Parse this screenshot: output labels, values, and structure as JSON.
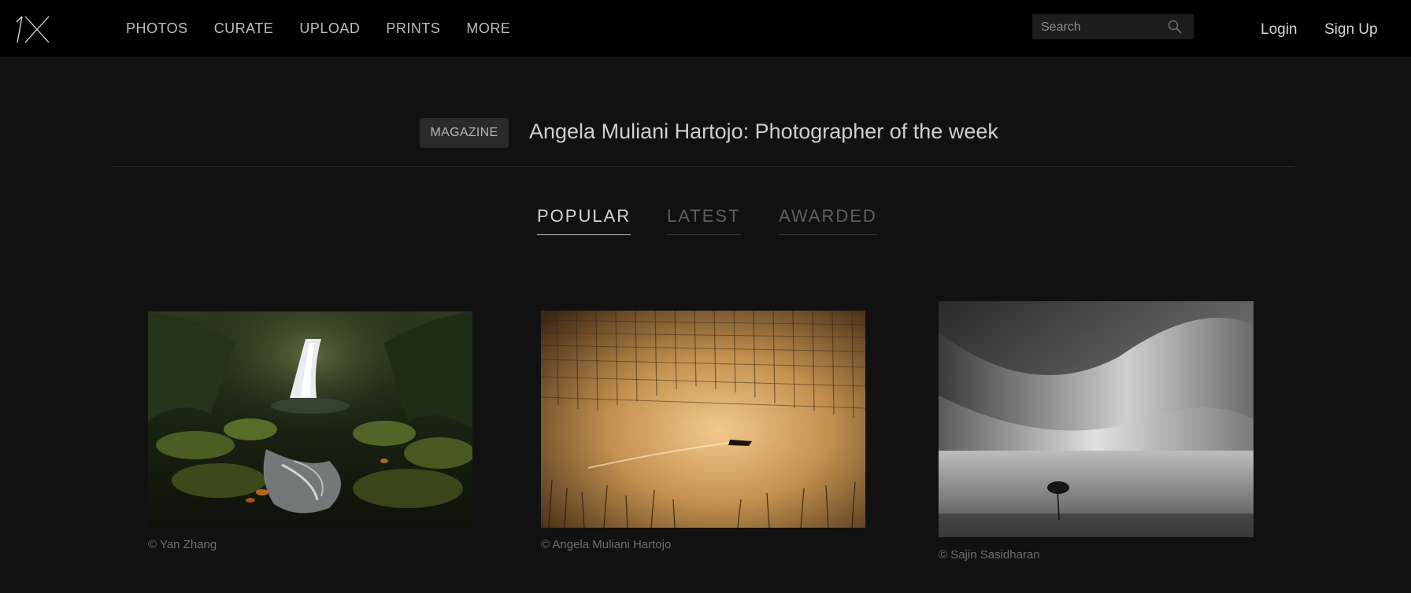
{
  "brand": {
    "logo_text": "1X"
  },
  "nav": {
    "items": [
      {
        "label": "PHOTOS"
      },
      {
        "label": "CURATE"
      },
      {
        "label": "UPLOAD"
      },
      {
        "label": "PRINTS"
      },
      {
        "label": "MORE"
      }
    ]
  },
  "search": {
    "placeholder": "Search",
    "icon": "search-icon"
  },
  "auth": {
    "login_label": "Login",
    "signup_label": "Sign Up"
  },
  "banner": {
    "badge": "MAGAZINE",
    "title": "Angela Muliani Hartojo: Photographer of the week"
  },
  "tabs": [
    {
      "label": "POPULAR",
      "active": true
    },
    {
      "label": "LATEST",
      "active": false
    },
    {
      "label": "AWARDED",
      "active": false
    }
  ],
  "photos": [
    {
      "credit": "© Yan Zhang"
    },
    {
      "credit": "© Angela Muliani Hartojo"
    },
    {
      "credit": "© Sajin Sasidharan"
    }
  ],
  "colors": {
    "background": "#111111",
    "topbar": "#000000",
    "active_tab": "#d4d4d4",
    "inactive_tab": "#5f5f5f"
  }
}
